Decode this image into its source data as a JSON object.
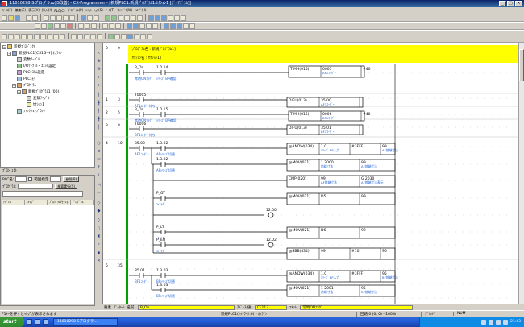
{
  "window": {
    "title": "11010298-Sプログラム(JS改善) - CX-Programmer - [新規PLC1.新規ﾌﾟﾛｸﾞﾗﾑ1.ｾｸｼｮﾝ1 [ﾀﾞｲｱｸﾞﾗﾑ]]",
    "minimize": "_",
    "maximize": "□",
    "close": "×"
  },
  "menu": [
    "ﾌｧｲﾙ(F)",
    "編集(E)",
    "表示(V)",
    "挿入(I)",
    "PLC(C)",
    "ﾌﾟﾛｸﾞﾗﾑ(P)",
    "ｼﾐｭﾚｰｼｮﾝ(S)",
    "ﾂｰﾙ(T)",
    "ｳｨﾝﾄﾞｳ(W)",
    "ﾍﾙﾌﾟ(H)"
  ],
  "tree": [
    {
      "label": "新規ﾌﾟﾛｼﾞｪｸﾄ",
      "indent": 0,
      "exp": "−",
      "icon": "folder"
    },
    {
      "label": "新規PLC1[CS1G-H] ｵﾌﾗｲﾝ",
      "indent": 1,
      "exp": "−",
      "icon": "plc"
    },
    {
      "label": "変数ﾃｰﾌﾞﾙ",
      "indent": 2,
      "exp": "",
      "icon": "table"
    },
    {
      "label": "I/Oﾃｰﾌﾞﾙ・ﾕﾆｯﾄ設定",
      "indent": 2,
      "exp": "",
      "icon": "io"
    },
    {
      "label": "PLCｼｽﾃﾑ設定",
      "indent": 2,
      "exp": "",
      "icon": "setting"
    },
    {
      "label": "PLCﾒﾓﾘ",
      "indent": 2,
      "exp": "",
      "icon": "memory"
    },
    {
      "label": "ﾌﾟﾛｸﾞﾗﾑ",
      "indent": 2,
      "exp": "−",
      "icon": "program"
    },
    {
      "label": "新規ﾌﾟﾛｸﾞﾗﾑ1 (00)",
      "indent": 3,
      "exp": "−",
      "icon": "program"
    },
    {
      "label": "変数ﾃｰﾌﾞﾙ",
      "indent": 4,
      "exp": "",
      "icon": "table"
    },
    {
      "label": "ｾｸｼｮﾝ1",
      "indent": 4,
      "exp": "",
      "icon": "section"
    },
    {
      "label": "ﾌｧﾝｸｼｮﾝﾌﾞﾛｯｸ",
      "indent": 2,
      "exp": "",
      "icon": "fb"
    }
  ],
  "tree_tab": "ﾌﾟﾛｼﾞｪｸﾄ",
  "search": {
    "plc_label": "PLC名:",
    "program_label": "ﾌﾟﾛｸﾞﾗﾑ:",
    "range_label": "範囲指定",
    "ref_button": "参照(R)",
    "search_button": "検索実行(S)",
    "columns": [
      "ｱﾄﾞﾚｽ",
      "ｽﾃｯﾌﾟ",
      "ﾌﾟﾛｸﾞﾗﾑ/ｾｸｼｮﾝ",
      "ﾌﾟﾛｸﾞﾗﾑ"
    ]
  },
  "ladder": {
    "header": {
      "line1": "[ﾌﾟﾛｸﾞﾗﾑ名 : 新規ﾌﾟﾛｸﾞﾗﾑ1]",
      "line2": "[ｾｸｼｮﾝ名 : ｾｸｼｮﾝ1]"
    },
    "rungs": [
      {
        "no": "0",
        "step": "0"
      },
      {
        "no": "1",
        "step": "3"
      },
      {
        "no": "2",
        "step": "5"
      },
      {
        "no": "3",
        "step": "8"
      },
      {
        "no": "4",
        "step": "10"
      },
      {
        "no": "5",
        "step": "35"
      }
    ],
    "contacts": [
      {
        "id": "c1",
        "addr": "P_On",
        "comment": "常時ONﾌﾗｸﾞ"
      },
      {
        "id": "c2",
        "addr": "1.0.14",
        "comment": "ｼﾘｰｽﾞ BP確認"
      },
      {
        "id": "c3",
        "addr": "T0005",
        "comment": "AF1ｺｰﾀﾞｰ待ち"
      },
      {
        "id": "c4",
        "addr": "P_On",
        "comment": "常時ONﾌﾗｸﾞ"
      },
      {
        "id": "c5",
        "addr": "1.0.15",
        "comment": "ｼﾘｰｽﾞ BP確認"
      },
      {
        "id": "c6",
        "addr": "T0006",
        "comment": "BF1ｺｰﾀﾞｰ待ち"
      },
      {
        "id": "c7",
        "addr": "35.00",
        "comment": "AF1ｺｰﾀﾞｰ"
      },
      {
        "id": "c8",
        "addr": "1.3.02",
        "comment": "AFｼﾘｰｽﾞ切替"
      },
      {
        "id": "c9",
        "addr": "1.3.02",
        "comment": "AFｼﾘｰｽﾞ切替"
      },
      {
        "id": "c10",
        "addr": "P_GT",
        "comment": ">ﾌﾗｸﾞ"
      },
      {
        "id": "c11",
        "addr": "P_LT",
        "comment": "<ﾌﾗｸﾞ"
      },
      {
        "id": "c12",
        "addr": "P_EQ",
        "comment": "=ﾌﾗｸﾞ"
      },
      {
        "id": "c13",
        "addr": "35.01",
        "comment": "BF1ｺｰﾀﾞｰ"
      },
      {
        "id": "c14",
        "addr": "1.3.03",
        "comment": "BFｼﾘｰｽﾞ切替"
      },
      {
        "id": "c15",
        "addr": "1.3.03",
        "comment": "BFｼﾘｰｽﾞ切替"
      }
    ],
    "instructions": [
      {
        "id": "i1",
        "op": "TIMH(015)",
        "a": "0005",
        "b": "#40",
        "ac": "AF1ｺｰﾀﾞｰ",
        "bc": ""
      },
      {
        "id": "i2",
        "op": "DIFU(013)",
        "a": "35.00",
        "b": "",
        "ac": "AF1ｺｰﾀﾞｰ",
        "bc": ""
      },
      {
        "id": "i3",
        "op": "TIMH(015)",
        "a": "0006",
        "b": "#40",
        "ac": "BF1ｺｰﾀﾞｰ",
        "bc": ""
      },
      {
        "id": "i4",
        "op": "DIFU(013)",
        "a": "35.01",
        "b": "",
        "ac": "BF1ｺｰﾀﾞｰ",
        "bc": ""
      },
      {
        "id": "i5",
        "op": "@ANDW(034)",
        "a": "1.0",
        "b": "#3FFF",
        "c": "99",
        "ac": "ｼﾘｰｽﾞ BP入力",
        "bc": "",
        "cc": "AF前端寸法"
      },
      {
        "id": "i6",
        "op": "@MOV(021)",
        "a": "1 2000",
        "b": "99",
        "ac": "前端寸法",
        "bc": "AF前端寸法"
      },
      {
        "id": "i7",
        "op": "CMP(020)",
        "a": "99",
        "b": "G 2030",
        "ac": "AF前端寸法",
        "bc": "AF前端寸法表示"
      },
      {
        "id": "i8",
        "op": "@MOV(021)",
        "a": "D5",
        "b": "99",
        "ac": "",
        "bc": ""
      },
      {
        "id": "i9",
        "op": "@MOV(021)",
        "a": "D6",
        "b": "99",
        "ac": "",
        "bc": ""
      },
      {
        "id": "i10",
        "op": "@SBB(434)",
        "a": "99",
        "b": "#10",
        "c": "96",
        "ac": "",
        "bc": "",
        "cc": ""
      },
      {
        "id": "i11",
        "op": "@ANDW(034)",
        "a": "1.0",
        "b": "#3FFF",
        "c": "95",
        "ac": "ｼﾘｰｽﾞ BP入力",
        "bc": "",
        "cc": "BF前端寸法"
      },
      {
        "id": "i12",
        "op": "@MOV(021)",
        "a": "1 2001",
        "b": "95",
        "ac": "前端寸法",
        "bc": "BF前端寸法"
      }
    ],
    "rung_labels": [
      "12.00",
      "12.02"
    ]
  },
  "infobar": {
    "name_label": "名前:",
    "name_value": "P_On",
    "addr_label": "ｱﾄﾞﾚｽ/値:",
    "addr_value": "CF113",
    "comment_label": "ｺﾒﾝﾄ:",
    "comment_value": "常時ONﾌﾗｸﾞ",
    "left_a": "要素",
    "left_b": "ﾃﾞｰﾀｰﾙ"
  },
  "statusbar": {
    "help": "F1ｷｰを押すとﾍﾙﾌﾟが表示されます",
    "plc": "新規PLC1(ﾈｯﾄﾜｰｸ:0) - ｵﾌﾗｲﾝ",
    "pos": "回路 0 (0, 0) - 100%",
    "mode": "ｸﾞﾘｯﾄﾞ",
    "num": "NUM"
  },
  "taskbar": {
    "start": "start",
    "item": "11010298-Sプログラ...",
    "time": "21:43"
  },
  "colors": {
    "header_bg": "#ffff00",
    "comment_text": "#1a5fd8",
    "rung_bar": "#00a000",
    "title_bar": "#0a246a"
  }
}
